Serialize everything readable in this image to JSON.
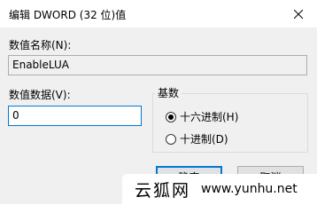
{
  "window": {
    "title": "编辑 DWORD (32 位)值"
  },
  "value_name": {
    "label": "数值名称(N):",
    "value": "EnableLUA"
  },
  "value_data": {
    "label": "数值数据(V):",
    "value": "0"
  },
  "base": {
    "label": "基数",
    "options": [
      {
        "label": "十六进制(H)",
        "checked": true
      },
      {
        "label": "十进制(D)",
        "checked": false
      }
    ]
  },
  "buttons": {
    "ok": "确定",
    "cancel": "取消"
  },
  "watermark": {
    "site": "云狐网",
    "url": "www.yunhu.net"
  }
}
